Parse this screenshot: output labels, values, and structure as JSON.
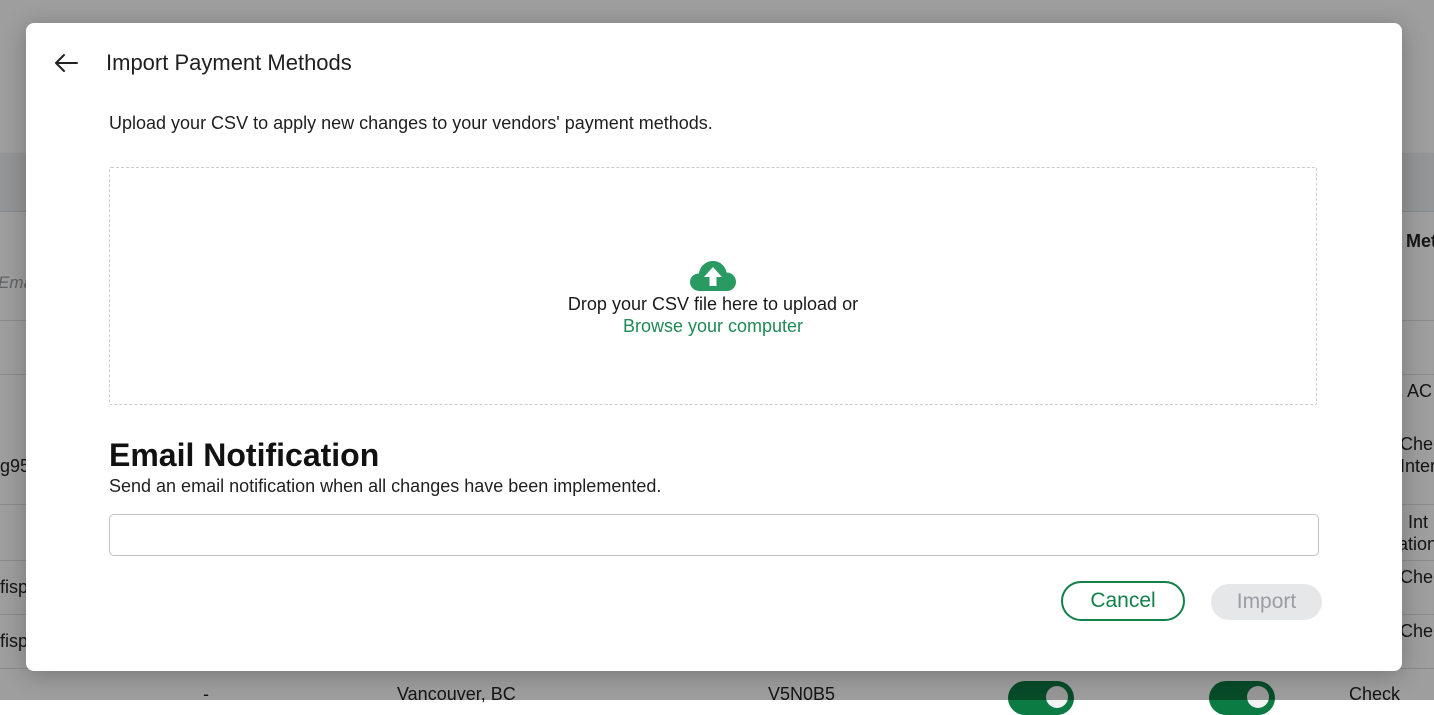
{
  "modal": {
    "title": "Import Payment Methods",
    "description": "Upload your CSV to apply new changes to your vendors' payment methods.",
    "dropzone": {
      "icon": "cloud-upload-icon",
      "drop_text": "Drop your CSV file here to upload or",
      "browse_label": "Browse your computer"
    },
    "email_section": {
      "heading": "Email Notification",
      "subtext": "Send an email notification when all changes have been implemented.",
      "input_value": "",
      "input_placeholder": ""
    },
    "buttons": {
      "cancel": "Cancel",
      "import": "Import"
    }
  },
  "background": {
    "header_fragment": "Met",
    "search_placeholder_fragment": "Ema",
    "row_fragments": [
      "g95",
      "fisp",
      "fisp"
    ],
    "right_fragments": [
      ", AC",
      "Che",
      "Inter",
      ", Int",
      "ation",
      "Che",
      "Che"
    ],
    "bottom_row": {
      "dash": "-",
      "city": "Vancouver, BC",
      "postal": "V5N0B5",
      "method": "Check"
    }
  },
  "colors": {
    "accent": "#13804a",
    "link": "#1f8a54",
    "toggle_on": "#0c7a43",
    "disabled_bg": "#e6e7e9"
  }
}
